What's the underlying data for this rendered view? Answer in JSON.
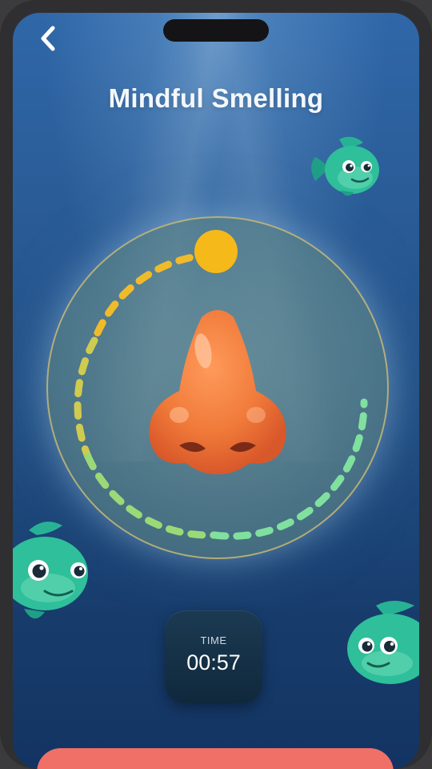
{
  "header": {
    "back_icon": "chevron-left-icon",
    "title": "Mindful Smelling"
  },
  "exercise": {
    "illustration": "nose",
    "progress_fraction": 0.95,
    "progress_colors": [
      "#f5b919",
      "#d3c846",
      "#9fd86f",
      "#7ee0a0"
    ]
  },
  "timer": {
    "label": "TIME",
    "value": "00:57"
  },
  "colors": {
    "background_top": "#2f67a8",
    "background_bottom": "#133462",
    "accent_dot": "#f5b919",
    "bottom_button": "#f07068",
    "fish": "#2fbf9a"
  }
}
